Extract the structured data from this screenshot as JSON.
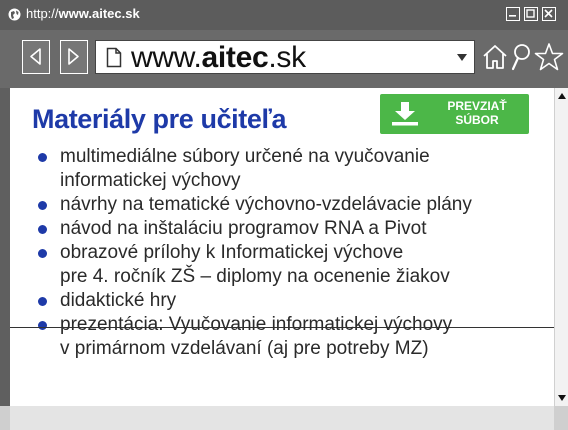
{
  "titlebar": {
    "protocol": "http://",
    "host": "www.aitec.sk"
  },
  "window_buttons": [
    "minimize",
    "maximize",
    "close"
  ],
  "address": {
    "prefix": "www.",
    "domain": "aitec",
    "suffix": ".sk"
  },
  "page": {
    "title": "Materiály pre učiteľa",
    "download": {
      "line1": "PREVZIAŤ",
      "line2": "SÚBOR"
    },
    "items": [
      {
        "lines": [
          "multimediálne súbory určené na vyučovanie",
          "informatickej výchovy"
        ]
      },
      {
        "lines": [
          "návrhy na tematické výchovno-vzdelávacie plány"
        ]
      },
      {
        "lines": [
          "návod na inštaláciu programov RNA a Pivot"
        ]
      },
      {
        "lines": [
          "obrazové prílohy k Informatickej výchove",
          "pre 4. ročník ZŠ – diplomy na ocenenie žiakov"
        ]
      },
      {
        "lines": [
          "didaktické hry"
        ]
      },
      {
        "lines": [
          "prezentácia: Vyučovanie informatickej výchovy",
          "v primárnom vzdelávaní (aj pre potreby MZ)"
        ]
      }
    ]
  },
  "colors": {
    "title_blue": "#1e3aa8",
    "bullet_blue": "#1e3aa8",
    "download_green": "#4cb748",
    "chrome_gray": "#5f5f5f"
  },
  "icons": [
    "globe-icon",
    "back-arrow-icon",
    "forward-arrow-icon",
    "document-icon",
    "dropdown-arrow-icon",
    "home-icon",
    "search-icon",
    "star-icon",
    "download-icon",
    "scroll-up-icon",
    "scroll-down-icon"
  ]
}
